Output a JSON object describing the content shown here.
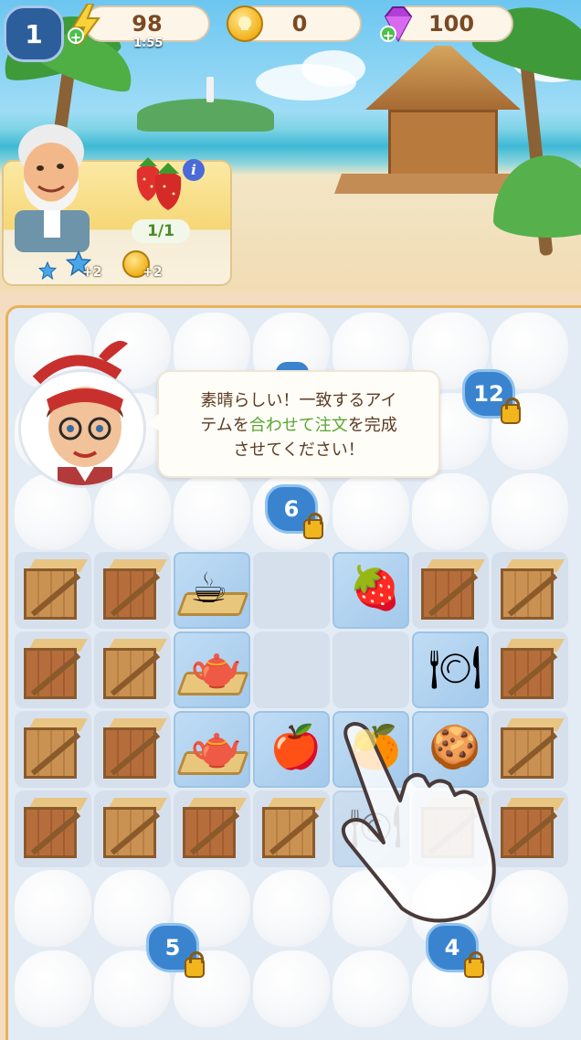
{
  "hud": {
    "level": "1",
    "energy": "98",
    "energy_timer": "1:55",
    "coins": "0",
    "gems": "100"
  },
  "order": {
    "item_icon": "strawberries-icon",
    "progress": "1/1",
    "rewards": [
      {
        "icon": "xp-star-icon",
        "amount": "+2"
      },
      {
        "icon": "coin-icon",
        "amount": "+2"
      }
    ]
  },
  "tutorial": {
    "text_before_1": "素晴らしい！一致するアイ",
    "text_before_2": "テムを",
    "highlight_1": "合わせて",
    "text_mid": "注文",
    "text_after_2": "を完成",
    "text_line3": "させてください！"
  },
  "locks": {
    "top_right": "12",
    "middle": "6",
    "bottom_left": "5",
    "bottom_right": "4"
  },
  "board": {
    "rows": [
      [
        "crate",
        "crate",
        "tray-cup",
        "empty",
        "strawberries",
        "crate",
        "crate"
      ],
      [
        "crate",
        "crate",
        "tray-teapot",
        "empty",
        "empty",
        "plate",
        "crate"
      ],
      [
        "crate",
        "crate",
        "tray-teapot-cup",
        "apple",
        "tangerine-plate",
        "cookies",
        "crate"
      ],
      [
        "crate",
        "crate",
        "crate",
        "crate",
        "plate-dim",
        "crate-dim",
        "crate"
      ]
    ]
  },
  "colors": {
    "accent_blue": "#3a84cf",
    "board_border": "#e9b25a",
    "text_brown": "#7a4a25",
    "highlight_green": "#58a632"
  }
}
